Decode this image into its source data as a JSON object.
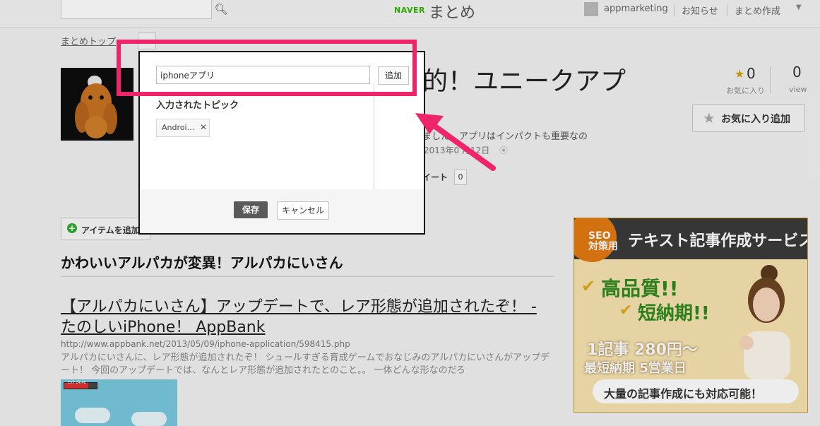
{
  "topbar": {
    "naver_logo": "NAVER",
    "site_title": "まとめ",
    "username": "appmarketing",
    "notice_link": "お知らせ",
    "create_link": "まとめ作成",
    "menu_caret": "▼"
  },
  "breadcrumb": {
    "label": "まとめトップ"
  },
  "header": {
    "title_fragment": "的！ユニークアプ",
    "description_fragment": "ました。アプリはインパクトも重要なの",
    "date_fragment": "2013年0 月12日",
    "tweet_fragment": "イート",
    "tweet_count": "0",
    "fav_count": "0",
    "fav_label": "お気に入り",
    "view_count": "0",
    "view_label": "view",
    "fav_button_label": "お気に入り追加"
  },
  "main": {
    "add_item_label": "アイテムを追加",
    "section_heading": "かわいいアルパカが変異！アルパカにいさん",
    "link_title": "【アルパカにいさん】アップデートで、レア形態が追加されたぞ！ - たのしいiPhone！ AppBank",
    "link_url": "http://www.appbank.net/2013/05/09/iphone-application/598415.php",
    "link_description": "アルパカにいさんに、レア形態が追加されたぞ！ シュールすぎる育成ゲームでおなじみのアルパカにいさんがアップデート！ 今回のアップデートでは、なんとレア形態が追加されたとのこと。。 一体どんな形なのだろ",
    "game_hp_label": "EXP  24/46"
  },
  "ad": {
    "seo_badge": "SEO\n対策用",
    "header_text": "テキスト記事作成サービス",
    "high_quality": "高品質!!",
    "short_delivery": "短納期!!",
    "price_line": "1記事 280円〜",
    "days_line": "最短納期 5営業日",
    "footer_text": "大量の記事作成にも対応可能！"
  },
  "modal": {
    "input_value": "iphoneアプリ",
    "add_button": "追加",
    "topics_label": "入力されたトピック",
    "topic_chip": "Androi…",
    "save_button": "保存",
    "cancel_button": "キャンセル"
  },
  "colors": {
    "highlight": "#f0246b",
    "brand_green": "#2db400"
  }
}
